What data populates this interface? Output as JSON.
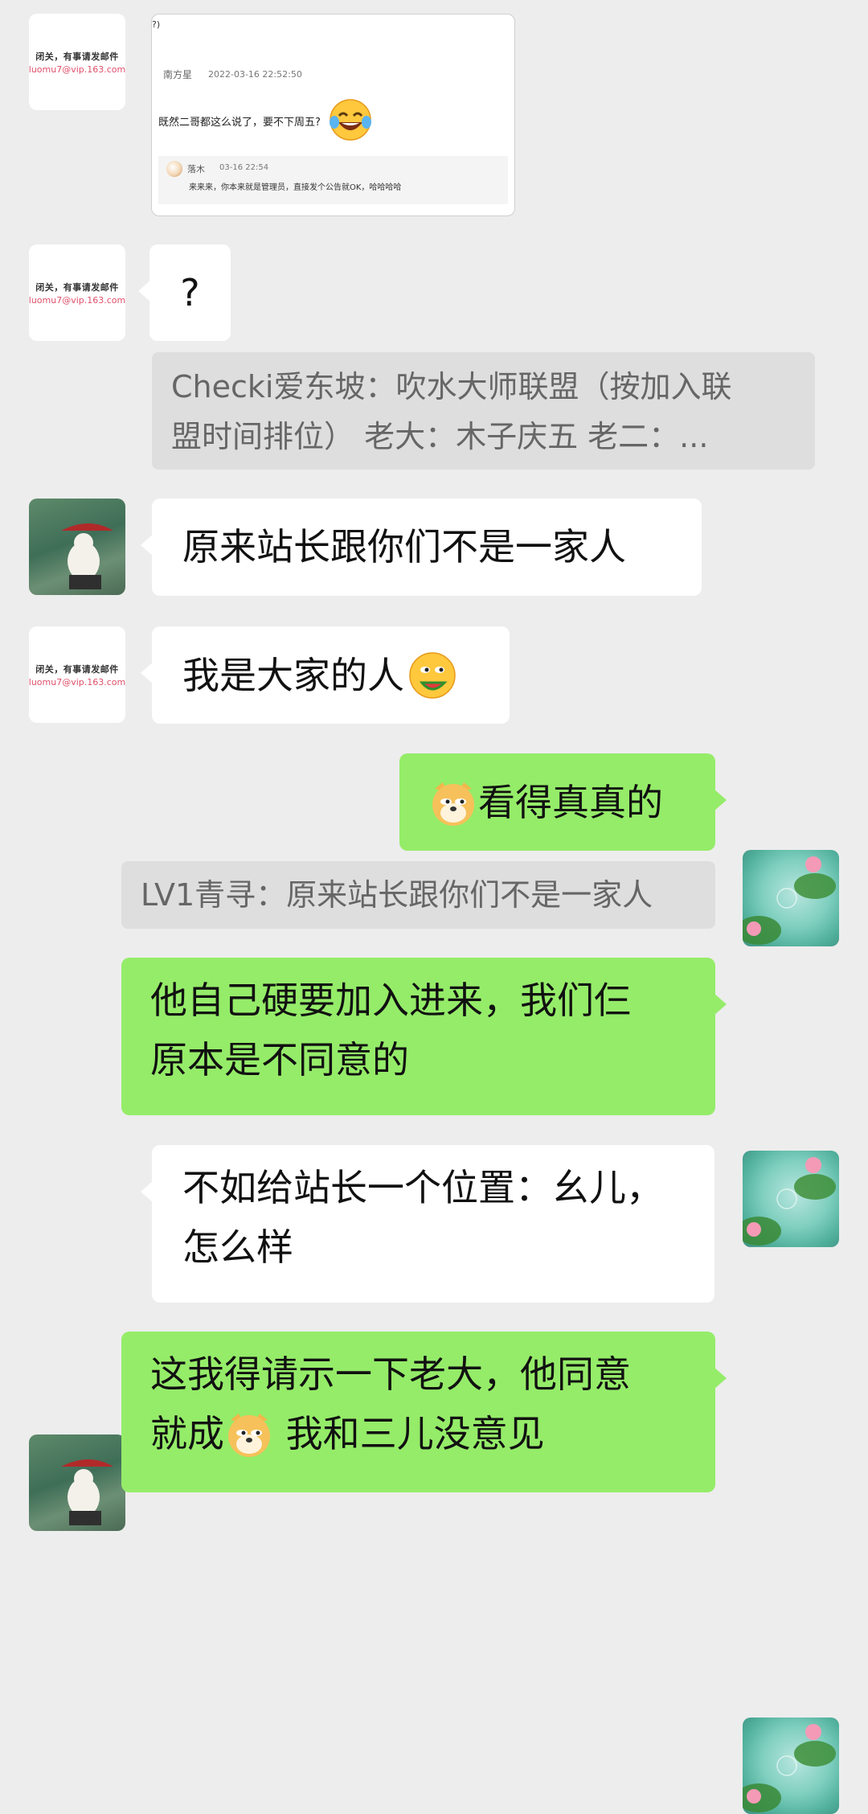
{
  "avatars": {
    "mail_text_line1": "闭关，有事请发邮件",
    "mail_text_line2": "luomu7@vip.163.com"
  },
  "screenshot_card": {
    "corner_mark": "?)",
    "poster": "南方星",
    "timestamp": "2022-03-16 22:52:50",
    "body": "既然二哥都这么说了，要不下周五?",
    "reply_name": "落木",
    "reply_time": "03-16 22:54",
    "reply_text": "来来来，你本来就是管理员，直接发个公告就OK，哈哈哈哈"
  },
  "messages": [
    {
      "text": "?"
    },
    {
      "text": "Checki爱东坡：吹水大师联盟（按加入联盟时间排位） 老大：木子庆五 老二：..."
    },
    {
      "text": "原来站长跟你们不是一家人"
    },
    {
      "text": "我是大家的人"
    },
    {
      "text": "看得真真的"
    },
    {
      "text": "LV1青寻：原来站长跟你们不是一家人"
    },
    {
      "text_line1": "他自己硬要加入进来，我们仨",
      "text_line2": "原本是不同意的"
    },
    {
      "text_line1": "不如给站长一个位置：幺儿，",
      "text_line2": "怎么样"
    },
    {
      "text_line1": "这我得请示一下老大，他同意",
      "text_line2_a": "就成",
      "text_line2_b": " 我和三儿没意见"
    }
  ],
  "quote1_line1": "Checki爱东坡：吹水大师联盟（按加入联",
  "quote1_line2": "盟时间排位） 老大：木子庆五 老二：...",
  "colors": {
    "background": "#ededed",
    "bubble_green": "#95ec69",
    "bubble_white": "#ffffff",
    "quote_gray": "#dedede"
  },
  "icons": [
    "laughing-tears-emoji",
    "watermelon-eat-emoji",
    "doge-emoji"
  ]
}
